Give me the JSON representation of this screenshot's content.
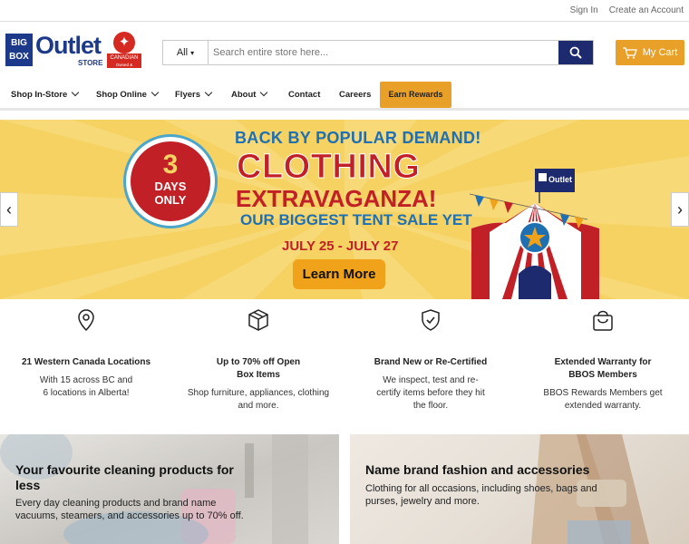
{
  "top_links": {
    "sign_in": "Sign In",
    "create_account": "Create an Account"
  },
  "logo": {
    "big": "BIG",
    "box": "BOX",
    "outlet": "Outlet",
    "store": "STORE",
    "canadian": "CANADIAN",
    "canadian_sub": "Owned & Operated"
  },
  "search": {
    "category": "All",
    "placeholder": "Search entire store here...",
    "icon": "search-icon"
  },
  "cart": {
    "label": "My Cart",
    "icon": "cart-icon"
  },
  "nav": {
    "items": [
      {
        "label": "Shop In-Store",
        "dropdown": true
      },
      {
        "label": "Shop Online",
        "dropdown": true
      },
      {
        "label": "Flyers",
        "dropdown": true
      },
      {
        "label": "About",
        "dropdown": true
      },
      {
        "label": "Contact",
        "dropdown": false
      },
      {
        "label": "Careers",
        "dropdown": false
      }
    ],
    "earn_rewards": "Earn Rewards"
  },
  "banner": {
    "badge_number": "3",
    "badge_line1": "DAYS",
    "badge_line2": "ONLY",
    "headline_top": "BACK BY POPULAR DEMAND!",
    "headline_main1": "CLOTHING",
    "headline_main2": "EXTRAVAGANZA!",
    "headline_sub": "OUR BIGGEST TENT SALE YET",
    "dates": "JULY 25 - JULY 27",
    "cta": "Learn More",
    "flag_text": "Outlet",
    "prev_arrow": "‹",
    "next_arrow": "›",
    "colors": {
      "background": "#f5d262",
      "red": "#c12027",
      "blue": "#1f6fb3",
      "gold": "#f0a21b"
    }
  },
  "features": [
    {
      "icon": "location-pin-icon",
      "title": "21 Western Canada Locations",
      "text1": "With 15 across BC and",
      "text2": "6 locations in Alberta!"
    },
    {
      "icon": "box-icon",
      "title": "Up to 70% off Open",
      "title2": "Box Items",
      "text1": "Shop furniture, appliances, clothing",
      "text2": "and more."
    },
    {
      "icon": "shield-check-icon",
      "title": "Brand New or Re-Certified",
      "text1": "We inspect, test and re-",
      "text2": "certify items before they hit",
      "text3": "the floor."
    },
    {
      "icon": "shopping-bag-icon",
      "title": "Extended Warranty for",
      "title2": "BBOS Members",
      "text1": "BBOS Rewards Members get",
      "text2": "extended warranty."
    }
  ],
  "promos": [
    {
      "title1": "Your favourite cleaning products for",
      "title2": "less",
      "text1": "Every day cleaning products and brand name",
      "text2": "vacuums, steamers, and accessories up to 70% off."
    },
    {
      "title1": "Name brand fashion and accessories",
      "text1": "Clothing for all occasions, including shoes, bags and",
      "text2": "purses, jewelry and more."
    }
  ],
  "colors": {
    "navy": "#1e2a6e",
    "accent": "#e8a028",
    "brand_blue": "#1d3a8a"
  }
}
